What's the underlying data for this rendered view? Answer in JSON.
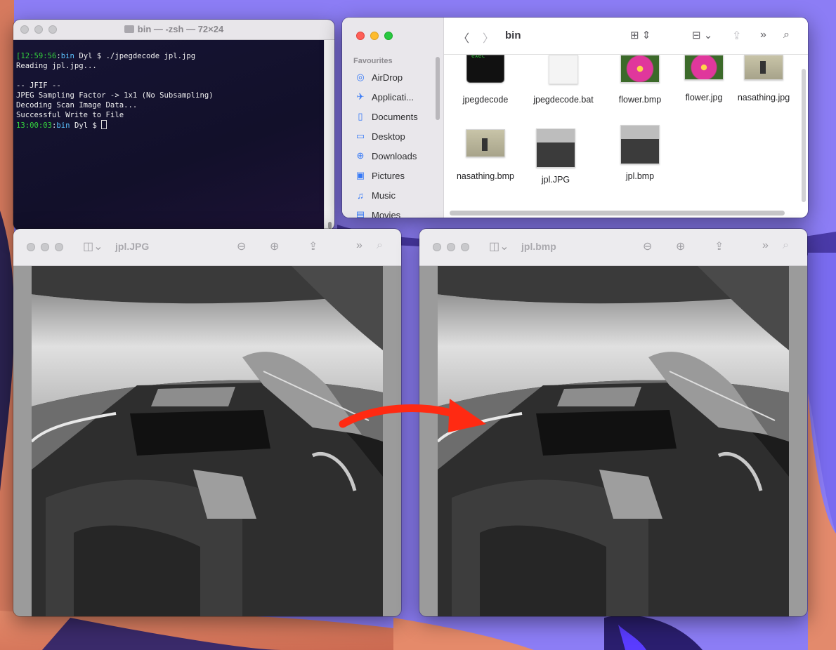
{
  "terminal": {
    "title": "bin — -zsh — 72×24",
    "lines": [
      {
        "time": "[12:59:56",
        "dir": "bin",
        "rest": " Dyl $ ./jpegdecode jpl.jpg"
      },
      {
        "text": "Reading jpl.jpg..."
      },
      {
        "text": ""
      },
      {
        "text": "-- JFIF --"
      },
      {
        "text": "JPEG Sampling Factor -> 1x1 (No Subsampling)"
      },
      {
        "text": "Decoding Scan Image Data..."
      },
      {
        "text": "Successful Write to File"
      },
      {
        "time": "13:00:03",
        "dir": "bin",
        "rest": " Dyl $ "
      }
    ]
  },
  "finder": {
    "path": "bin",
    "sidebar_heading": "Favourites",
    "sidebar": [
      {
        "label": "AirDrop",
        "icon": "airdrop-icon"
      },
      {
        "label": "Applicati...",
        "icon": "applications-icon"
      },
      {
        "label": "Documents",
        "icon": "document-icon"
      },
      {
        "label": "Desktop",
        "icon": "desktop-icon"
      },
      {
        "label": "Downloads",
        "icon": "download-icon"
      },
      {
        "label": "Pictures",
        "icon": "pictures-icon"
      },
      {
        "label": "Music",
        "icon": "music-icon"
      },
      {
        "label": "Movies",
        "icon": "movies-icon"
      }
    ],
    "files": [
      {
        "name": "jpegdecode",
        "kind": "exec",
        "exec_label": "exec"
      },
      {
        "name": "jpegdecode.bat",
        "kind": "blank"
      },
      {
        "name": "flower.bmp",
        "kind": "flower"
      },
      {
        "name": "flower.jpg",
        "kind": "flower"
      },
      {
        "name": "nasathing.jpg",
        "kind": "nasa"
      },
      {
        "name": "nasathing.bmp",
        "kind": "nasa"
      },
      {
        "name": "jpl.JPG",
        "kind": "rover"
      },
      {
        "name": "jpl.bmp",
        "kind": "rover"
      }
    ]
  },
  "previewA": {
    "title": "jpl.JPG"
  },
  "previewB": {
    "title": "jpl.bmp"
  },
  "colors": {
    "arrow": "#ff2a12",
    "term_green": "#34d13d",
    "term_blue": "#5cc4ff"
  }
}
